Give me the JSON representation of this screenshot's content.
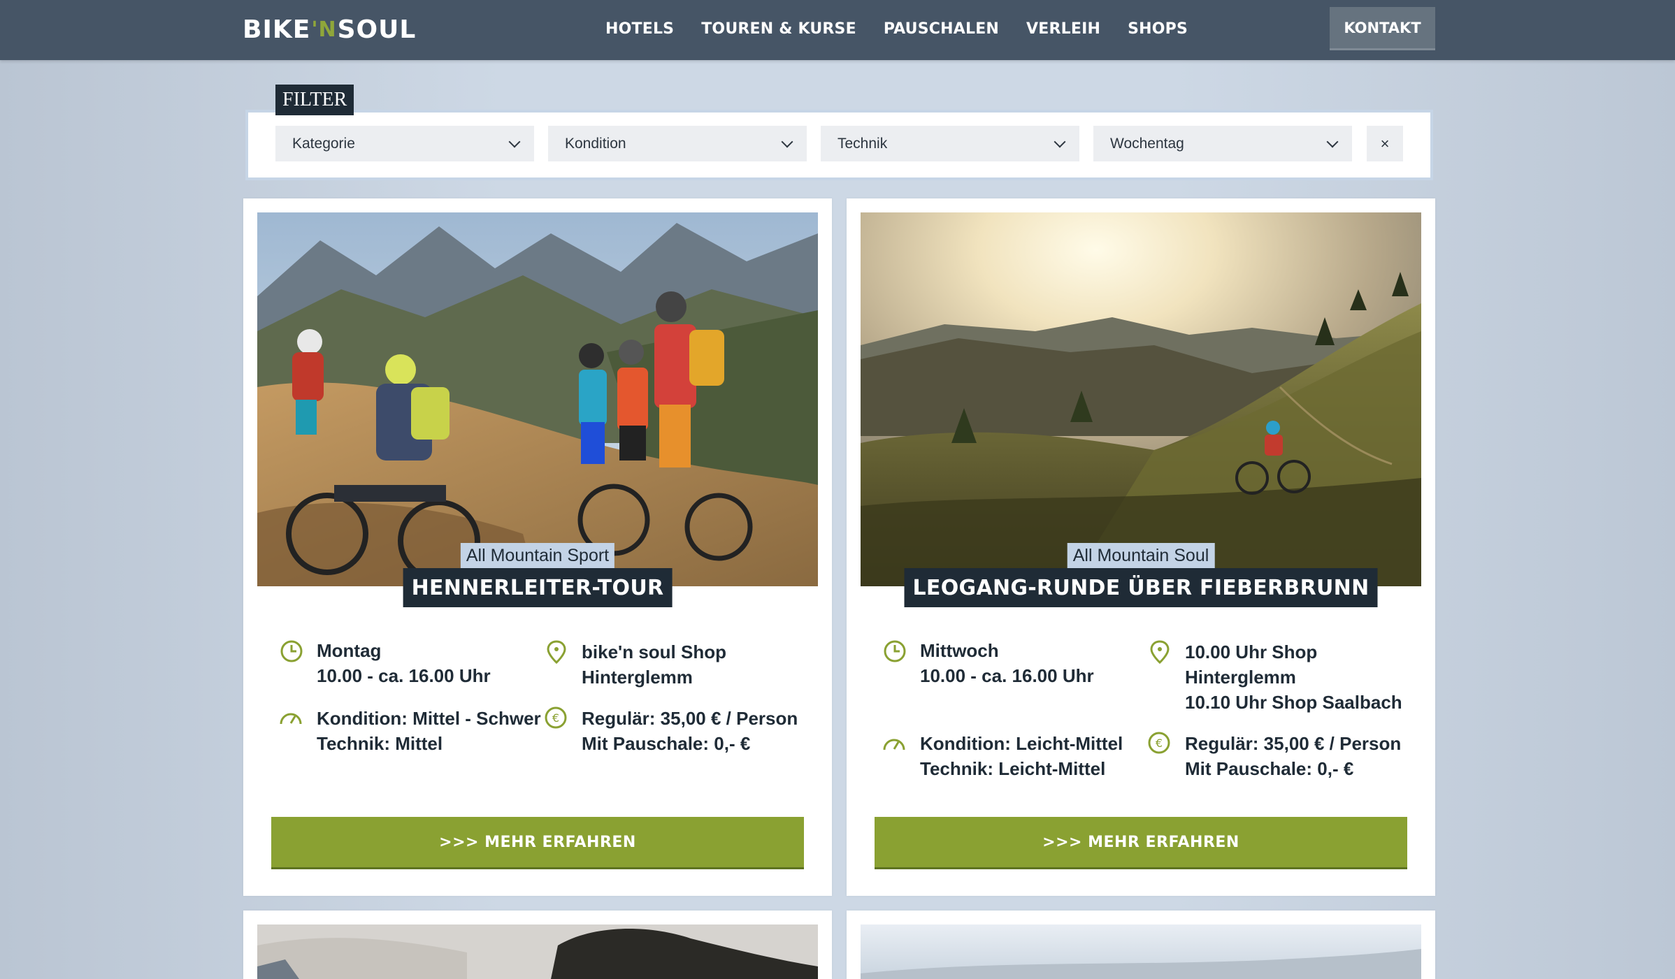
{
  "nav": {
    "logo_left": "BIKE",
    "logo_apos": "'N",
    "logo_right": "SOUL",
    "items": [
      "HOTELS",
      "TOUREN & KURSE",
      "PAUSCHALEN",
      "VERLEIH",
      "SHOPS"
    ],
    "contact": "KONTAKT"
  },
  "filter": {
    "label": "FILTER",
    "selects": [
      "Kategorie",
      "Kondition",
      "Technik",
      "Wochentag"
    ],
    "clear_symbol": "×"
  },
  "tours": [
    {
      "category": "All Mountain Sport",
      "title": "HENNERLEITER-TOUR",
      "day": "Montag",
      "time": "10.00 - ca. 16.00 Uhr",
      "location_lines": [
        "bike'n soul Shop",
        "Hinterglemm"
      ],
      "fitness": "Kondition: Mittel - Schwer",
      "technique": "Technik: Mittel",
      "price_regular": "Regulär: 35,00 € / Person",
      "price_package": "Mit Pauschale: 0,- €",
      "button": ">>> MEHR ERFAHREN"
    },
    {
      "category": "All Mountain Soul",
      "title": "LEOGANG-RUNDE ÜBER FIEBERBRUNN",
      "day": "Mittwoch",
      "time": "10.00 - ca. 16.00 Uhr",
      "location_lines": [
        "10.00 Uhr Shop",
        "Hinterglemm",
        "10.10 Uhr Shop Saalbach"
      ],
      "fitness": "Kondition: Leicht-Mittel",
      "technique": "Technik: Leicht-Mittel",
      "price_regular": "Regulär: 35,00 € / Person",
      "price_package": "Mit Pauschale: 0,- €",
      "button": ">>> MEHR ERFAHREN"
    }
  ],
  "colors": {
    "nav_bg": "#465566",
    "accent_green": "#8aa132",
    "dark_navy": "#1f2b36",
    "category_bg": "#c3d3e6"
  },
  "icons": [
    "clock-icon",
    "map-pin-icon",
    "speedometer-icon",
    "euro-icon",
    "chevron-down-icon",
    "close-icon"
  ]
}
